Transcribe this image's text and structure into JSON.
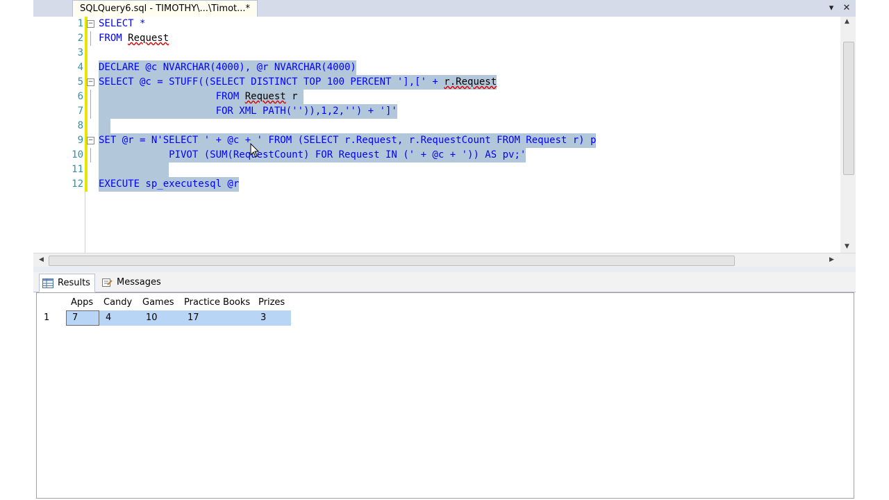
{
  "document_tab": {
    "title": "SQLQuery6.sql - TIMOTHY\\...\\Timot...*"
  },
  "tab_controls": {
    "dropdown": "▾",
    "close": "✕"
  },
  "editor": {
    "line_numbers": [
      "1",
      "2",
      "3",
      "4",
      "5",
      "6",
      "7",
      "8",
      "9",
      "10",
      "11",
      "12"
    ],
    "lines": {
      "l1": "SELECT *",
      "l2a": "FROM ",
      "l2b": "Request",
      "l4": "DECLARE @c NVARCHAR(4000), @r NVARCHAR(4000)",
      "l5a": "SELECT @c = STUFF((SELECT DISTINCT TOP 100 PERCENT '],[' + ",
      "l5b": "r.Request",
      "l6a": "                    FROM ",
      "l6b": "Request",
      "l6c": " r ",
      "l7": "                    FOR XML PATH('')),1,2,'') + ']'",
      "l8": "  ",
      "l9": "SET @r = N'SELECT ' + @c + ' FROM (SELECT r.Request, r.RequestCount FROM Request r) p",
      "l10": "            PIVOT (SUM(RequestCount) FOR Request IN (' + @c + ')) AS pv;'",
      "l11": "            ",
      "l12": "EXECUTE sp_executesql @r"
    }
  },
  "results_tabs": [
    {
      "label": "Results",
      "active": true
    },
    {
      "label": "Messages",
      "active": false
    }
  ],
  "grid": {
    "columns": [
      "Apps",
      "Candy",
      "Games",
      "Practice Books",
      "Prizes"
    ],
    "rows": [
      {
        "row_number": "1",
        "values": [
          "7",
          "4",
          "10",
          "17",
          "3"
        ]
      }
    ]
  },
  "colors": {
    "keyword": "#0000ff",
    "line_number": "#2b91af",
    "selection": "#b3c7db",
    "grid_selection": "#b8d5f5"
  }
}
